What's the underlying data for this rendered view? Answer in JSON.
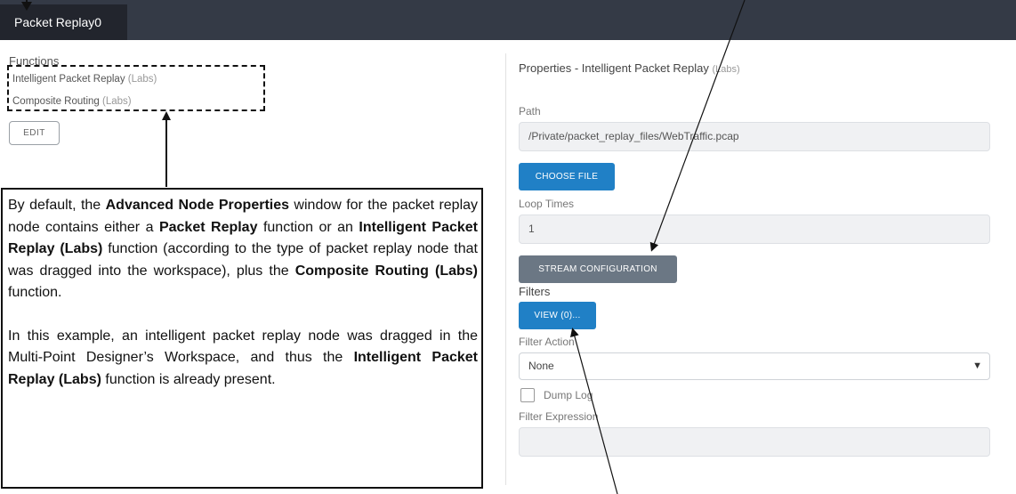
{
  "tab": {
    "label": "Packet Replay0"
  },
  "functions": {
    "title": "Functions",
    "items": [
      {
        "name": "Intelligent Packet Replay",
        "tag": "(Labs)"
      },
      {
        "name": "Composite Routing",
        "tag": "(Labs)"
      }
    ],
    "edit_label": "EDIT"
  },
  "callout": {
    "p1": [
      "By default, the ",
      "Advanced Node Properties",
      " window for the packet replay node contains either a ",
      "Packet Replay",
      " function or an ",
      "Intelligent Packet Replay (Labs)",
      " function (according to the type of packet replay node that was dragged into the workspace), plus the ",
      "Composite Routing (Labs)",
      " function."
    ],
    "p2": [
      "In this example, an intelligent packet replay node was dragged in the Multi-Point Designer’s Workspace, and thus the ",
      "Intelligent Packet Replay (Labs)",
      " function is already present."
    ]
  },
  "properties": {
    "title": "Properties  - Intelligent Packet Replay",
    "title_tag": "(Labs)",
    "path_label": "Path",
    "path_value": "/Private/packet_replay_files/WebTraffic.pcap",
    "choose_file": "CHOOSE FILE",
    "loop_label": "Loop Times",
    "loop_value": "1",
    "stream_config": "STREAM CONFIGURATION",
    "filters_label": "Filters",
    "view_button": "VIEW (0)...",
    "filter_action_label": "Filter Action",
    "filter_action_value": "None",
    "dump_log_label": "Dump Log",
    "dump_log_checked": false,
    "filter_expression_label": "Filter Expression",
    "filter_expression_value": ""
  },
  "icons": {
    "select_chevron": "chevron-down-icon"
  },
  "colors": {
    "topbar": "#343a46",
    "tab": "#22252d",
    "primary_button": "#2080c6",
    "secondary_button": "#6b7784"
  }
}
